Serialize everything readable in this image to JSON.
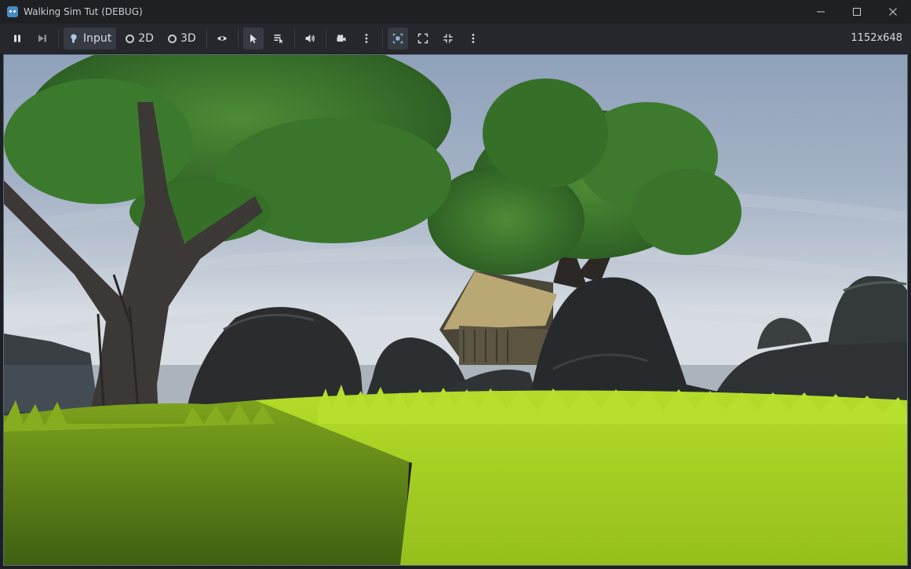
{
  "window": {
    "title": "Walking Sim Tut (DEBUG)",
    "icon": "godot-icon"
  },
  "toolbar": {
    "input_label": "Input",
    "mode_2d_label": "2D",
    "mode_3d_label": "3D",
    "resolution": "1152x648"
  },
  "icons": [
    "pause-icon",
    "step-frame-icon",
    "input-icon",
    "eye-icon",
    "select-cursor-icon",
    "list-select-icon",
    "speaker-icon",
    "camera-icon",
    "more-icon",
    "embed-icon",
    "fullscreen-icon",
    "shrink-icon"
  ],
  "colors": {
    "sky_top": "#97a8bf",
    "grass": "#a9d12a",
    "foliage": "#3f7a2e",
    "rock": "#2a2c2e"
  }
}
